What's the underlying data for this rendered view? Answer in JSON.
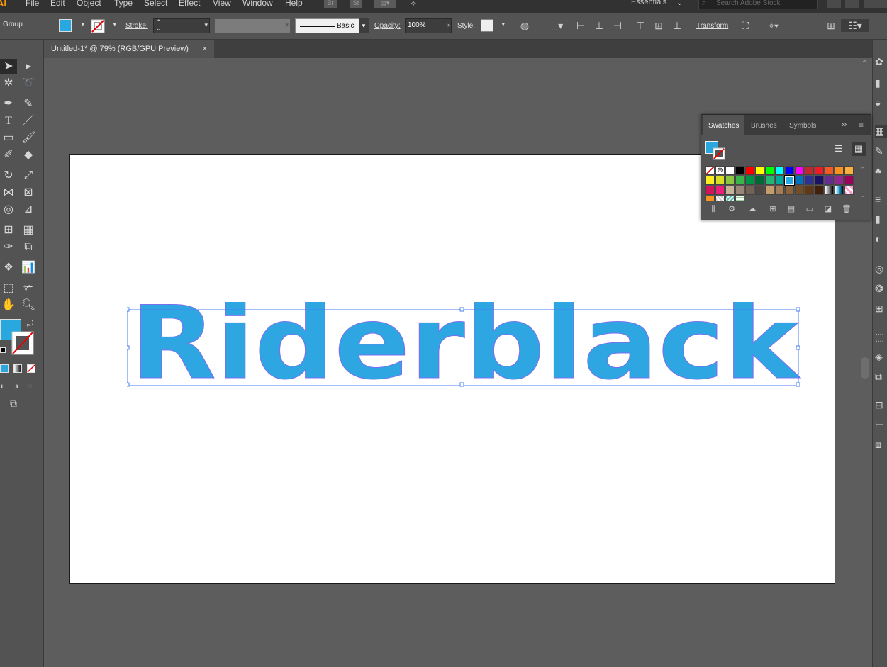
{
  "menubar": {
    "logo": "Ai",
    "items": [
      "File",
      "Edit",
      "Object",
      "Type",
      "Select",
      "Effect",
      "View",
      "Window",
      "Help"
    ],
    "bridge": "Br",
    "stock": "St",
    "workspace": "Essentials",
    "search_placeholder": "Search Adobe Stock"
  },
  "control": {
    "selection": "Group",
    "fill_color": "#29a8e0",
    "stroke_label": "Stroke:",
    "brush_label": "Basic",
    "opacity_label": "Opacity:",
    "opacity_value": "100%",
    "style_label": "Style:",
    "transform_label": "Transform"
  },
  "document": {
    "tab_title": "Untitled-1* @ 79% (RGB/GPU Preview)",
    "close": "×"
  },
  "artwork": {
    "text": "Riderblack",
    "color": "#2ea6e2",
    "outline": "#7b6ff0"
  },
  "swatches": {
    "tabs": [
      "Swatches",
      "Brushes",
      "Symbols"
    ],
    "active_tab": "Swatches",
    "rows": [
      [
        "none",
        "reg",
        "#ffffff",
        "#000000",
        "#ff0000",
        "#ffff00",
        "#00ff00",
        "#00ffff",
        "#0000ff",
        "#ff00ff",
        "#c1272d",
        "#ed1c24",
        "#f15a24",
        "#f7931e",
        "#fbb03b"
      ],
      [
        "#fcee21",
        "#d9e021",
        "#8cc63f",
        "#39b54a",
        "#009245",
        "#006837",
        "#22b573",
        "#00a99d",
        "#29abe2",
        "#0071bc",
        "#2e3192",
        "#1b1464",
        "#662d91",
        "#93278f",
        "#9e005d"
      ],
      [
        "#d4145a",
        "#ed1e79",
        "#c7b299",
        "#998675",
        "#736357",
        "#534741",
        "#c69c6d",
        "#a67c52",
        "#8c6239",
        "#754c24",
        "#603813",
        "#42210b",
        "#grad1",
        "#grad2",
        "#grad3"
      ],
      [
        "#f7931e",
        "#pattern1",
        "#pattern2",
        "#pattern3"
      ]
    ],
    "selected_index": 23
  }
}
